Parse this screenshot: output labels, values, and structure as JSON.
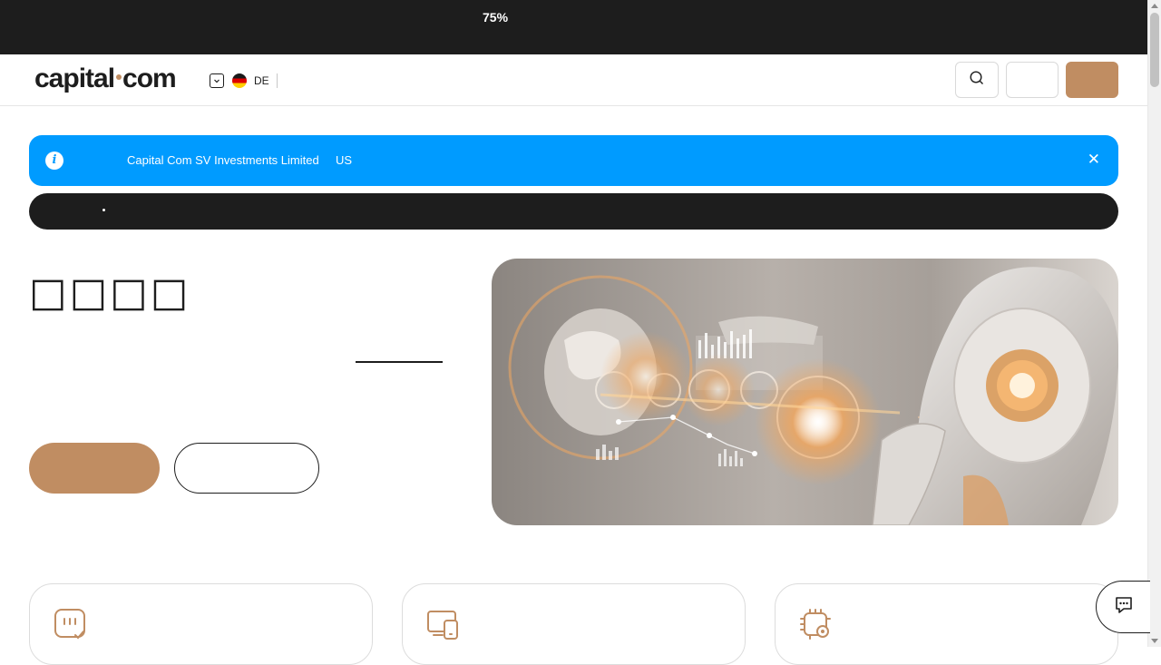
{
  "topbar": {
    "zoom_label": "75%"
  },
  "header": {
    "logo_text_left": "capital",
    "logo_text_right": "com",
    "language_code": "DE",
    "icons": {
      "language": "chevron-down-icon",
      "flag": "germany-flag-icon",
      "search": "search-icon"
    }
  },
  "notice": {
    "entity": "Capital Com SV Investments Limited",
    "region": "US",
    "icons": {
      "info": "info-icon",
      "close": "close-icon"
    },
    "info_glyph": "i",
    "close_glyph": "✕"
  },
  "hero": {
    "title": "□□□□",
    "image_name": "ai-robot-world-map-image"
  },
  "cards": [
    {
      "icon": "chat-check-icon"
    },
    {
      "icon": "devices-icon"
    },
    {
      "icon": "ai-chip-settings-icon"
    }
  ],
  "chat": {
    "icon": "chat-bubble-icon"
  },
  "colors": {
    "dark": "#1d1d1d",
    "accent": "#c08d62",
    "notice_blue": "#009bff",
    "border": "#dcdcdc"
  }
}
